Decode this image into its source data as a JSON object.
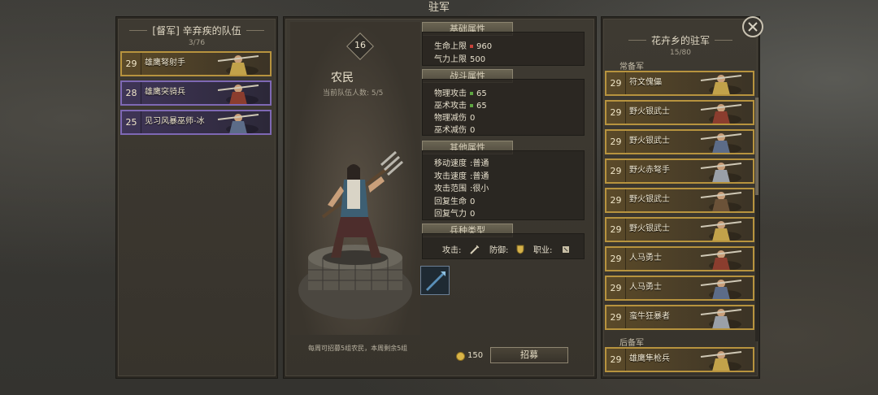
{
  "window": {
    "title": "驻军"
  },
  "party": {
    "title": "[督军] 辛弃疾的队伍",
    "count": "3/76",
    "units": [
      {
        "level": "29",
        "name": "雄鹰弩射手",
        "tier": "gold"
      },
      {
        "level": "28",
        "name": "雄鹰突骑兵",
        "tier": "purple"
      },
      {
        "level": "25",
        "name": "见习风暴巫师-冰",
        "tier": "purple"
      }
    ]
  },
  "unit": {
    "level": "16",
    "name": "农民",
    "party_count": "当前队伍人数: 5/5",
    "sections": {
      "basic": "基础属性",
      "combat": "战斗属性",
      "other": "其他属性",
      "type": "兵种类型"
    },
    "basic": [
      {
        "label": "生命上限",
        "value": "960",
        "marker": "red"
      },
      {
        "label": "气力上限",
        "value": "500",
        "marker": "none"
      }
    ],
    "combat": [
      {
        "label": "物理攻击",
        "value": "65",
        "marker": "green"
      },
      {
        "label": "巫术攻击",
        "value": "65",
        "marker": "green"
      },
      {
        "label": "物理减伤",
        "value": "0",
        "marker": "none"
      },
      {
        "label": "巫术减伤",
        "value": "0",
        "marker": "none"
      }
    ],
    "other": [
      {
        "label": "移动速度",
        "value": ":普通"
      },
      {
        "label": "攻击速度",
        "value": ":普通"
      },
      {
        "label": "攻击范围",
        "value": ":很小"
      },
      {
        "label": "回复生命",
        "value": "0"
      },
      {
        "label": "回复气力",
        "value": "0"
      }
    ],
    "type_labels": {
      "attack": "攻击:",
      "defense": "防御:",
      "class": "职业:"
    },
    "recruit_note": "每周可招募5组农民，本周剩余5组",
    "cost": "150",
    "recruit_label": "招募"
  },
  "garrison": {
    "title": "花卉乡的驻军",
    "count": "15/80",
    "regular_label": "常备军",
    "reserve_label": "后备军",
    "regular": [
      {
        "level": "29",
        "name": "符文傀儡"
      },
      {
        "level": "29",
        "name": "野火银武士"
      },
      {
        "level": "29",
        "name": "野火银武士"
      },
      {
        "level": "29",
        "name": "野火赤弩手"
      },
      {
        "level": "29",
        "name": "野火银武士"
      },
      {
        "level": "29",
        "name": "野火银武士"
      },
      {
        "level": "29",
        "name": "人马勇士"
      },
      {
        "level": "29",
        "name": "人马勇士"
      },
      {
        "level": "29",
        "name": "蛮牛狂暴者"
      }
    ],
    "reserve": [
      {
        "level": "29",
        "name": "雄鹰隼枪兵"
      }
    ]
  },
  "colors": {
    "gold_border": "#b7933e",
    "purple_border": "#7e68b4",
    "background": "#3a3833"
  }
}
